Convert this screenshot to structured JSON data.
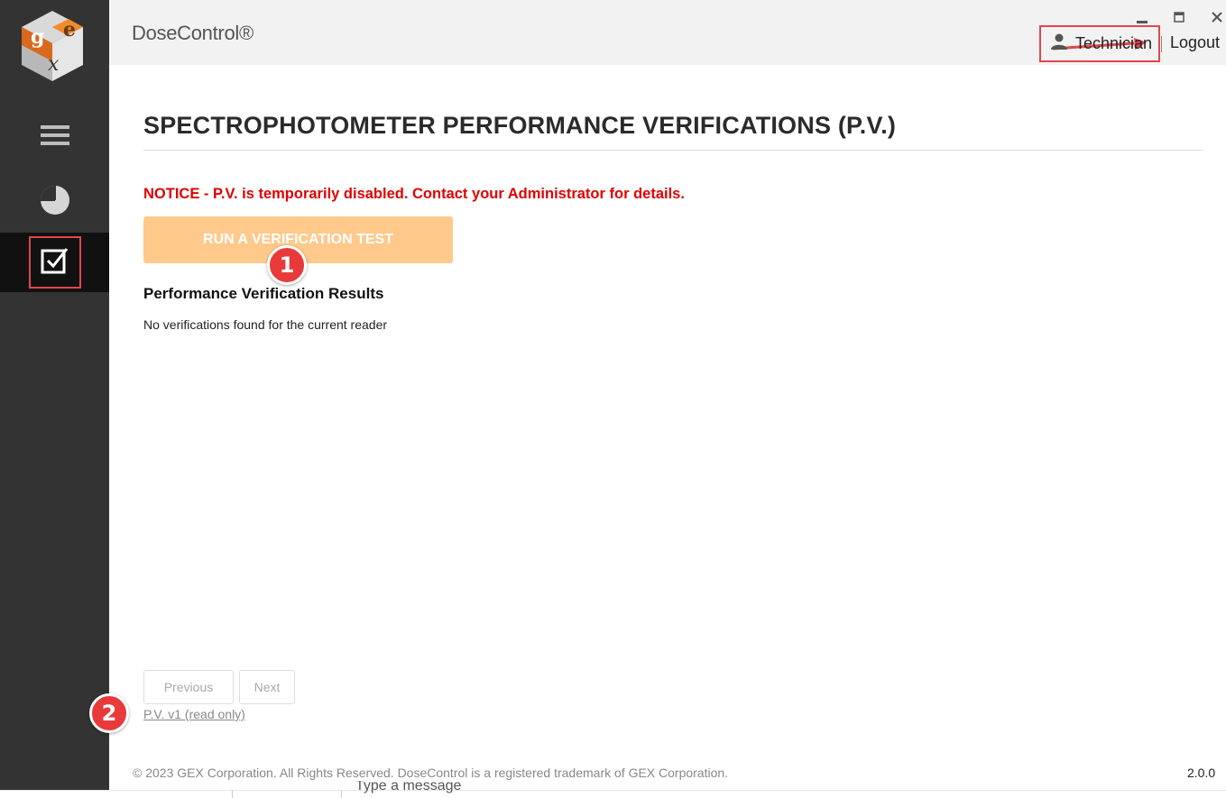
{
  "header": {
    "app_title": "DoseControl®",
    "user_name": "Technician",
    "logout_label": "Logout",
    "window_controls": {
      "minimize": "▁",
      "maximize": "▭",
      "close": "✕"
    }
  },
  "sidebar": {
    "logo_letters": [
      "g",
      "e",
      "x"
    ],
    "items": [
      {
        "icon": "hamburger-menu-icon"
      },
      {
        "icon": "pie-chart-icon"
      },
      {
        "icon": "checkbox-icon",
        "active": true
      }
    ]
  },
  "main": {
    "title": "SPECTROPHOTOMETER PERFORMANCE VERIFICATIONS (P.V.)",
    "notice": "NOTICE - P.V. is temporarily disabled. Contact your Administrator for details.",
    "run_button_label": "RUN A VERIFICATION TEST",
    "results_heading": "Performance Verification Results",
    "results_empty": "No verifications found for the current reader"
  },
  "pagination": {
    "previous_label": "Previous",
    "next_label": "Next",
    "version_link": "P.V. v1 (read only)"
  },
  "footer": {
    "copyright": "© 2023 GEX Corporation. All Rights Reserved. DoseControl is a registered trademark of GEX Corporation.",
    "version": "2.0.0"
  },
  "annotations": {
    "badge_1": "1",
    "badge_2": "2"
  },
  "bottom_strip": {
    "message_placeholder": "Type a message"
  },
  "colors": {
    "sidebar_bg": "#333333",
    "active_nav_bg": "#111111",
    "accent_button": "#ffc98c",
    "notice_red": "#e00000",
    "annotation_red": "#e0474c"
  }
}
